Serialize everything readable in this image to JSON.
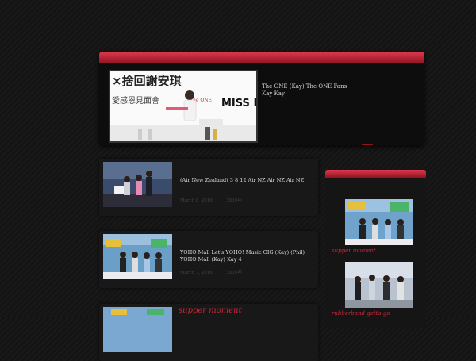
{
  "featured": {
    "headline_image_text": "×捨回謝安琪",
    "subline_image_text": "愛感恩見面會",
    "brand_image_text": "The ONE",
    "sign_image_text": "MISS KAY",
    "caption": "The ONE (Kay) The ONE Fans Kay Kay"
  },
  "posts": [
    {
      "excerpt": "(Air New Zealand) 3 8 12 Air NZ Air NZ Air NZ",
      "date": "March 8, 2016",
      "year_tag": "2016年"
    },
    {
      "excerpt": "YOHO Mall Let's YOHO! Music GIG (Kay) (Phil) YOHO Mall (Kay) Kay 4",
      "date": "March 7, 2016",
      "year_tag": "2016年"
    }
  ],
  "bottom_section": {
    "title": "supper moment"
  },
  "sidebar": {
    "items": [
      {
        "label": "supper moment"
      },
      {
        "label": "rubberband gotta go"
      }
    ]
  },
  "colors": {
    "accent_red": "#c8283a",
    "background": "#141414"
  }
}
